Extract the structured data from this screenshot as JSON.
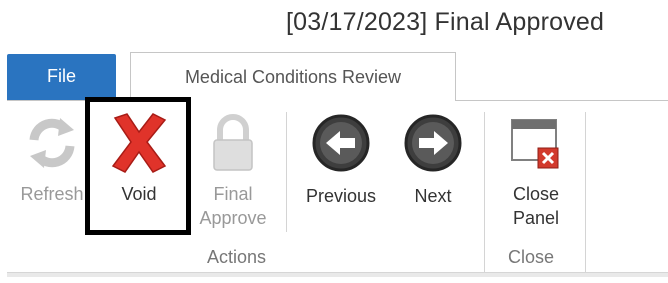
{
  "window": {
    "title": "[03/17/2023] Final Approved"
  },
  "tabs": {
    "file_label": "File",
    "active_label": "Medical Conditions Review"
  },
  "ribbon": {
    "buttons": [
      {
        "label": "Refresh",
        "icon": "refresh-icon",
        "enabled": false
      },
      {
        "label": "Void",
        "icon": "void-x-icon",
        "enabled": true
      },
      {
        "label_line1": "Final",
        "label_line2": "Approve",
        "icon": "padlock-icon",
        "enabled": false
      },
      {
        "label": "Previous",
        "icon": "arrow-left-icon",
        "enabled": true
      },
      {
        "label": "Next",
        "icon": "arrow-right-icon",
        "enabled": true
      },
      {
        "label_line1": "Close",
        "label_line2": "Panel",
        "icon": "close-panel-icon",
        "enabled": true
      }
    ],
    "groups": [
      {
        "label": "Actions"
      },
      {
        "label": "Close"
      }
    ]
  },
  "colors": {
    "file_tab": "#2a74c0",
    "void_x": "#e0332a",
    "highlight_border": "#000000"
  }
}
